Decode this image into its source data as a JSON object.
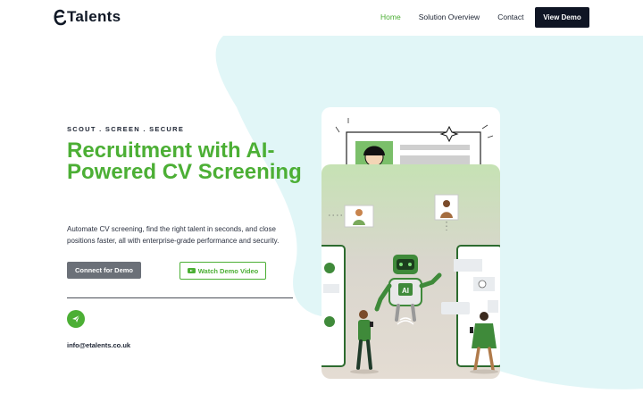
{
  "header": {
    "logo_text": "Talents",
    "nav": [
      {
        "label": "Home",
        "active": true
      },
      {
        "label": "Solution Overview",
        "active": false
      },
      {
        "label": "Contact",
        "active": false
      }
    ],
    "cta_label": "View Demo"
  },
  "hero": {
    "kicker": "SCOUT . SCREEN . SECURE",
    "title": "Recruitment with AI-Powered CV Screening",
    "description": "Automate CV screening, find the right talent in seconds, and close positions faster, all with enterprise-grade performance and security.",
    "connect_label": "Connect for Demo",
    "watch_label": "Watch Demo Video",
    "email": "info@etalents.co.uk"
  },
  "illustration": {
    "robot_badge": "AI",
    "icon": "robot-hiring-illustration"
  },
  "colors": {
    "brand_green": "#4caf35",
    "dark": "#0f1524",
    "button_gray": "#6b7078",
    "blob": "#e1f6f7"
  }
}
